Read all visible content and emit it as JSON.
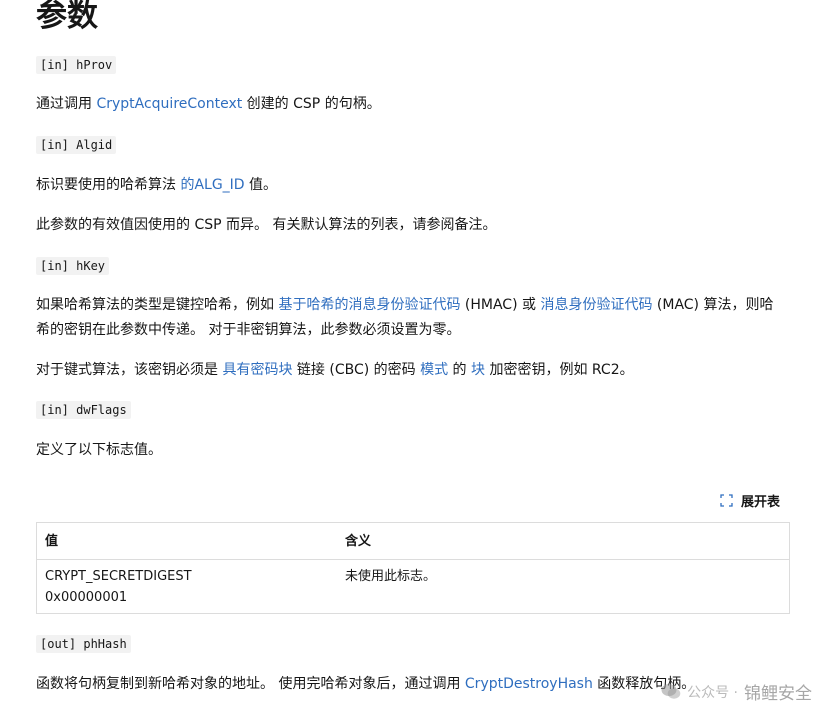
{
  "heading": "参数",
  "params": {
    "hProv": "[in] hProv",
    "algid": "[in] Algid",
    "hKey": "[in] hKey",
    "dwFlags": "[in] dwFlags",
    "phHash": "[out] phHash"
  },
  "p_hprov": {
    "t1": "通过调用 ",
    "link1": "CryptAcquireContext",
    "t2": " 创建的 CSP 的句柄。"
  },
  "p_algid1": {
    "t1": "标识要使用的哈希算法 ",
    "link1": "的ALG_ID",
    "t2": " 值。"
  },
  "p_algid2": "此参数的有效值因使用的 CSP 而异。 有关默认算法的列表，请参阅备注。",
  "p_hkey1": {
    "t1": "如果哈希算法的类型是键控哈希，例如 ",
    "link1": "基于哈希的消息身份验证代码",
    "t2": " (HMAC) 或 ",
    "link2": "消息身份验证代码",
    "t3": " (MAC) 算法，则哈希的密钥在此参数中传递。 对于非密钥算法，此参数必须设置为零。"
  },
  "p_hkey2": {
    "t1": "对于键式算法，该密钥必须是 ",
    "link1": "具有密码块",
    "t2": " 链接 (CBC) 的密码 ",
    "link2": "模式",
    "t3": " 的 ",
    "link3": "块",
    "t4": " 加密密钥，例如 RC2。"
  },
  "p_flags": "定义了以下标志值。",
  "expand_label": "展开表",
  "table": {
    "col1": "值",
    "col2": "含义",
    "row1_name": "CRYPT_SECRETDIGEST",
    "row1_value": "0x00000001",
    "row1_meaning": "未使用此标志。"
  },
  "p_phhash": {
    "t1": "函数将句柄复制到新哈希对象的地址。 使用完哈希对象后，通过调用 ",
    "link1": "CryptDestroyHash",
    "t2": " 函数释放句柄。"
  },
  "watermark": {
    "prefix": "公众号 ·",
    "name": "锦鲤安全"
  },
  "colors": {
    "link": "#2f6ebf",
    "code_bg": "#f2f2f2",
    "border": "#dcdcdc"
  }
}
